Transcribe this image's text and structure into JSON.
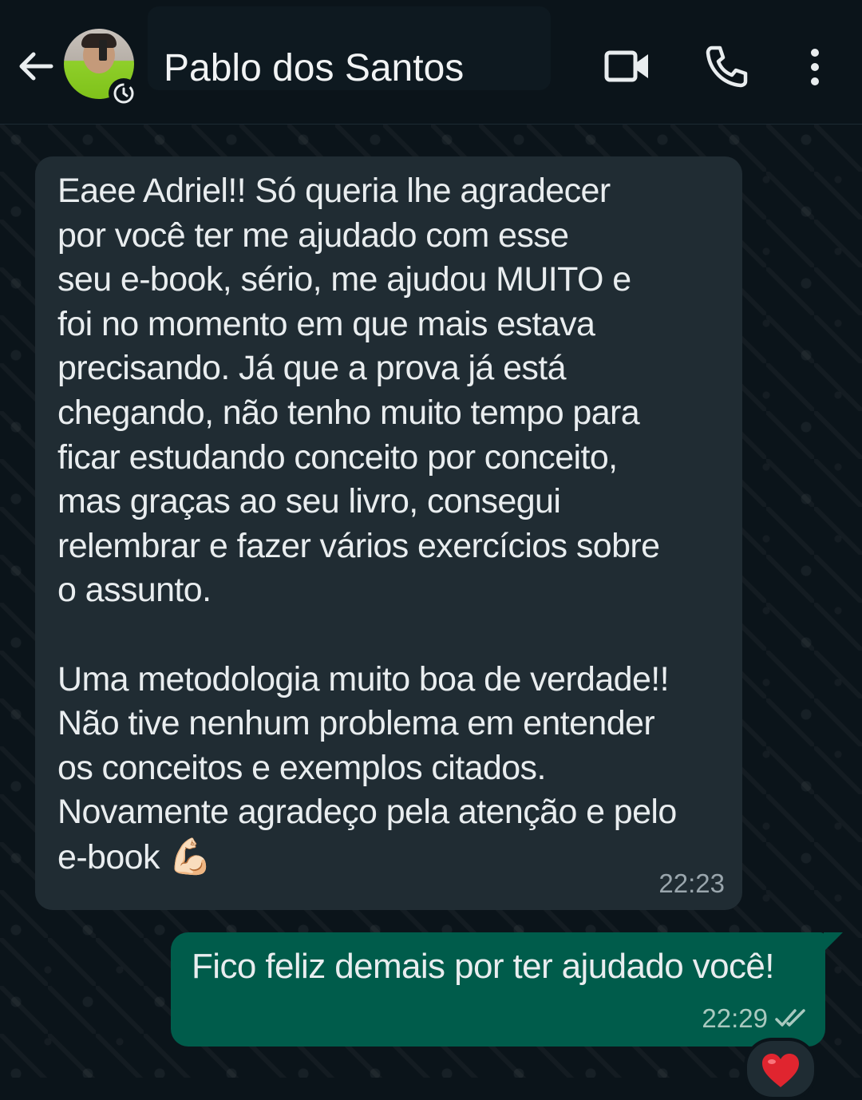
{
  "header": {
    "contact_name": "Pablo dos Santos",
    "icons": [
      "back-arrow-icon",
      "avatar",
      "status-clock-icon",
      "video-call-icon",
      "voice-call-icon",
      "more-options-icon"
    ]
  },
  "messages": [
    {
      "direction": "incoming",
      "text": "Eaee Adriel!! Só queria lhe agradecer\npor você ter me ajudado com esse\nseu e-book, sério, me ajudou MUITO e\nfoi no momento em que mais estava\nprecisando. Já que a prova já está\nchegando, não tenho muito tempo para\nficar estudando conceito por conceito,\nmas graças ao seu livro, consegui\nrelembrar e fazer vários exercícios sobre\no assunto.\n\nUma metodologia muito boa de verdade!!\nNão tive nenhum problema em entender\nos conceitos e exemplos citados.\nNovamente agradeço pela atenção e pelo\ne-book ",
      "emoji": "💪🏻",
      "time": "22:23"
    },
    {
      "direction": "outgoing",
      "text": "Fico feliz demais por ter ajudado você!",
      "time": "22:29",
      "status": "read",
      "reaction": "❤️"
    }
  ],
  "colors": {
    "background": "#0b141a",
    "incoming_bubble": "#202c33",
    "outgoing_bubble": "#005c4b",
    "read_ticks": "#a9c9bf"
  }
}
